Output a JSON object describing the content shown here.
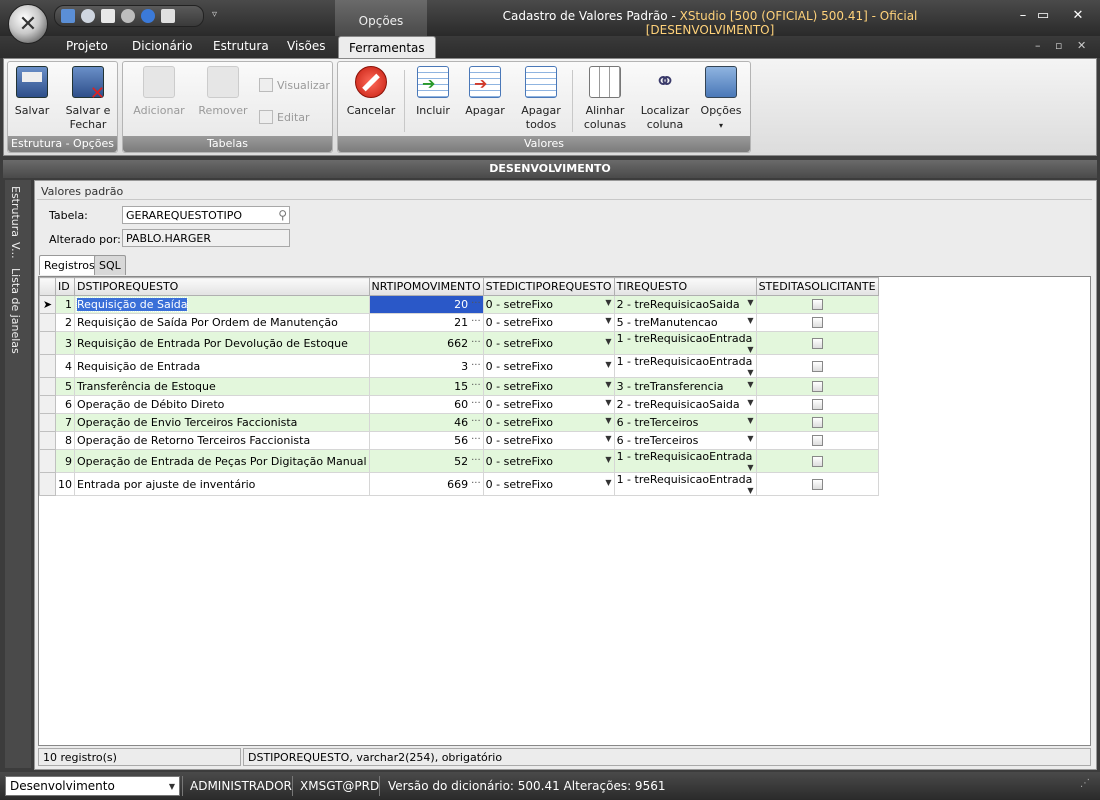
{
  "app": {
    "title_main": "Cadastro de Valores Padrão - ",
    "title_accent": "XStudio [500 (OFICIAL) 500.41] - Oficial [DESENVOLVIMENTO]",
    "context_tab": "Opções",
    "orb_icon": "app-orb-icon"
  },
  "tabs": [
    "Projeto",
    "Dicionário",
    "Estrutura",
    "Visões",
    "Ferramentas"
  ],
  "active_tab": "Ferramentas",
  "ribbon": {
    "groups": {
      "estrutura": "Estrutura - Opções",
      "tabelas": "Tabelas",
      "valores": "Valores"
    },
    "buttons": {
      "salvar": "Salvar",
      "salvar_fechar_1": "Salvar e",
      "salvar_fechar_2": "Fechar",
      "adicionar": "Adicionar",
      "remover": "Remover",
      "visualizar": "Visualizar",
      "editar": "Editar",
      "cancelar": "Cancelar",
      "incluir": "Incluir",
      "apagar": "Apagar",
      "apagar_todos_1": "Apagar",
      "apagar_todos_2": "todos",
      "alinhar_1": "Alinhar",
      "alinhar_2": "colunas",
      "localizar_1": "Localizar",
      "localizar_2": "coluna",
      "opcoes": "Opções"
    }
  },
  "env_header": "DESENVOLVIMENTO",
  "side_tabs": [
    "Estrutura",
    "V...",
    "Lista de janelas"
  ],
  "form": {
    "section_title": "Valores padrão",
    "tabela_label": "Tabela:",
    "tabela_value": "GERAREQUESTOTIPO",
    "alterado_label": "Alterado por:",
    "alterado_value": "PABLO.HARGER"
  },
  "panel_tabs": [
    "Registros",
    "SQL"
  ],
  "grid": {
    "columns": [
      "ID",
      "DSTIPOREQUESTO",
      "NRTIPOMOVIMENTO",
      "STEDICTIPOREQUESTO",
      "TIREQUESTO",
      "STEDITASOLICITANTE"
    ],
    "rows": [
      {
        "id": "1",
        "desc": "Requisição de Saída",
        "num": "20",
        "st": "0 - setreFixo",
        "tip": "2 - treRequisicaoSaida"
      },
      {
        "id": "2",
        "desc": "Requisição de Saída Por Ordem de Manutenção",
        "num": "21",
        "st": "0 - setreFixo",
        "tip": "5 - treManutencao"
      },
      {
        "id": "3",
        "desc": "Requisição de Entrada Por Devolução de Estoque",
        "num": "662",
        "st": "0 - setreFixo",
        "tip": "1 - treRequisicaoEntrada"
      },
      {
        "id": "4",
        "desc": "Requisição de Entrada",
        "num": "3",
        "st": "0 - setreFixo",
        "tip": "1 - treRequisicaoEntrada"
      },
      {
        "id": "5",
        "desc": "Transferência de Estoque",
        "num": "15",
        "st": "0 - setreFixo",
        "tip": "3 - treTransferencia"
      },
      {
        "id": "6",
        "desc": "Operação de Débito Direto",
        "num": "60",
        "st": "0 - setreFixo",
        "tip": "2 - treRequisicaoSaida"
      },
      {
        "id": "7",
        "desc": "Operação de Envio Terceiros Faccionista",
        "num": "46",
        "st": "0 - setreFixo",
        "tip": "6 - treTerceiros"
      },
      {
        "id": "8",
        "desc": "Operação de Retorno Terceiros Faccionista",
        "num": "56",
        "st": "0 - setreFixo",
        "tip": "6 - treTerceiros"
      },
      {
        "id": "9",
        "desc": "Operação de Entrada de Peças Por Digitação Manual",
        "num": "52",
        "st": "0 - setreFixo",
        "tip": "1 - treRequisicaoEntrada"
      },
      {
        "id": "10",
        "desc": "Entrada por ajuste de inventário",
        "num": "669",
        "st": "0 - setreFixo",
        "tip": "1 - treRequisicaoEntrada"
      }
    ]
  },
  "status": {
    "count": "10 registro(s)",
    "field_info": "DSTIPOREQUESTO, varchar2(254), obrigatório"
  },
  "statusbar": {
    "env": "Desenvolvimento",
    "user": "ADMINISTRADOR",
    "conn": "XMSGT@PRD",
    "version": "Versão do dicionário: 500.41 Alterações: 9561"
  }
}
